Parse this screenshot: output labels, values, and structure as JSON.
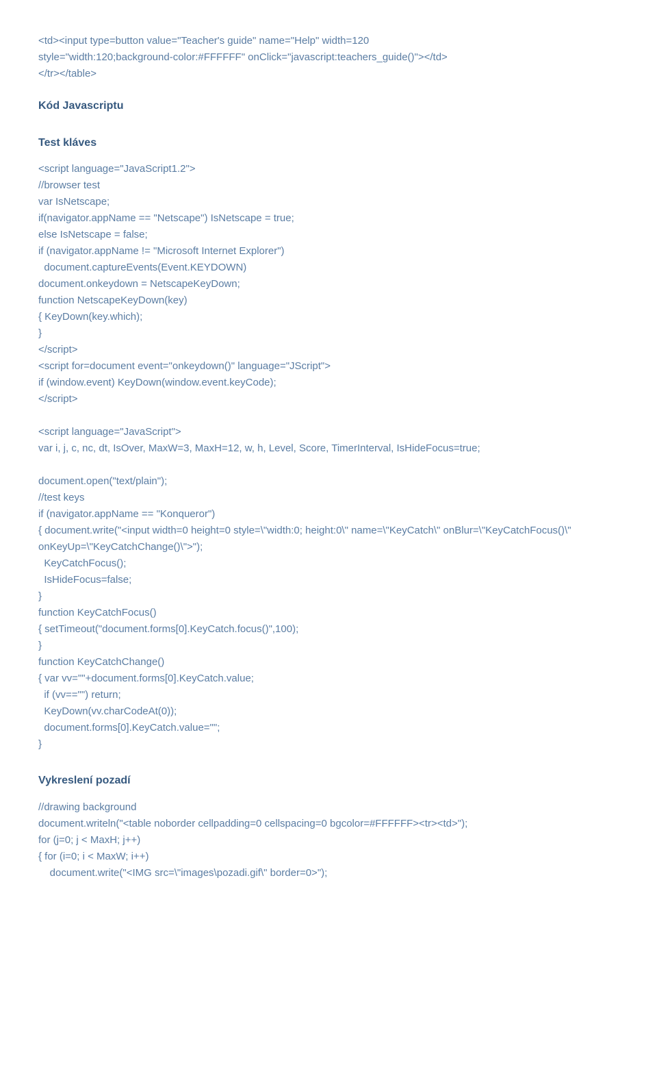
{
  "section1": {
    "code": "<td><input type=button value=\"Teacher's guide\" name=\"Help\" width=120\nstyle=\"width:120;background-color:#FFFFFF\" onClick=\"javascript:teachers_guide()\"></td>\n</tr></table>"
  },
  "heading1": "Kód Javascriptu",
  "heading2": "Test kláves",
  "section2": {
    "code": "<script language=\"JavaScript1.2\">\n//browser test\nvar IsNetscape;\nif(navigator.appName == \"Netscape\") IsNetscape = true;\nelse IsNetscape = false;\nif (navigator.appName != \"Microsoft Internet Explorer\")\n  document.captureEvents(Event.KEYDOWN)\ndocument.onkeydown = NetscapeKeyDown;\nfunction NetscapeKeyDown(key)\n{ KeyDown(key.which);\n}\n</script>\n<script for=document event=\"onkeydown()\" language=\"JScript\">\nif (window.event) KeyDown(window.event.keyCode);\n</script>\n\n<script language=\"JavaScript\">\nvar i, j, c, nc, dt, IsOver, MaxW=3, MaxH=12, w, h, Level, Score, TimerInterval, IsHideFocus=true;\n\ndocument.open(\"text/plain\");\n//test keys\nif (navigator.appName == \"Konqueror\")\n{ document.write(\"<input width=0 height=0 style=\\\"width:0; height:0\\\" name=\\\"KeyCatch\\\" onBlur=\\\"KeyCatchFocus()\\\" onKeyUp=\\\"KeyCatchChange()\\\">\");\n  KeyCatchFocus();\n  IsHideFocus=false;\n}\nfunction KeyCatchFocus()\n{ setTimeout(\"document.forms[0].KeyCatch.focus()\",100);\n}\nfunction KeyCatchChange()\n{ var vv=\"\"+document.forms[0].KeyCatch.value;\n  if (vv==\"\") return;\n  KeyDown(vv.charCodeAt(0));\n  document.forms[0].KeyCatch.value=\"\";\n}"
  },
  "heading3": "Vykreslení pozadí",
  "section3": {
    "code": "//drawing background\ndocument.writeln(\"<table noborder cellpadding=0 cellspacing=0 bgcolor=#FFFFFF><tr><td>\");\nfor (j=0; j < MaxH; j++)\n{ for (i=0; i < MaxW; i++)\n    document.write(\"<IMG src=\\\"images\\pozadi.gif\\\" border=0>\");"
  }
}
